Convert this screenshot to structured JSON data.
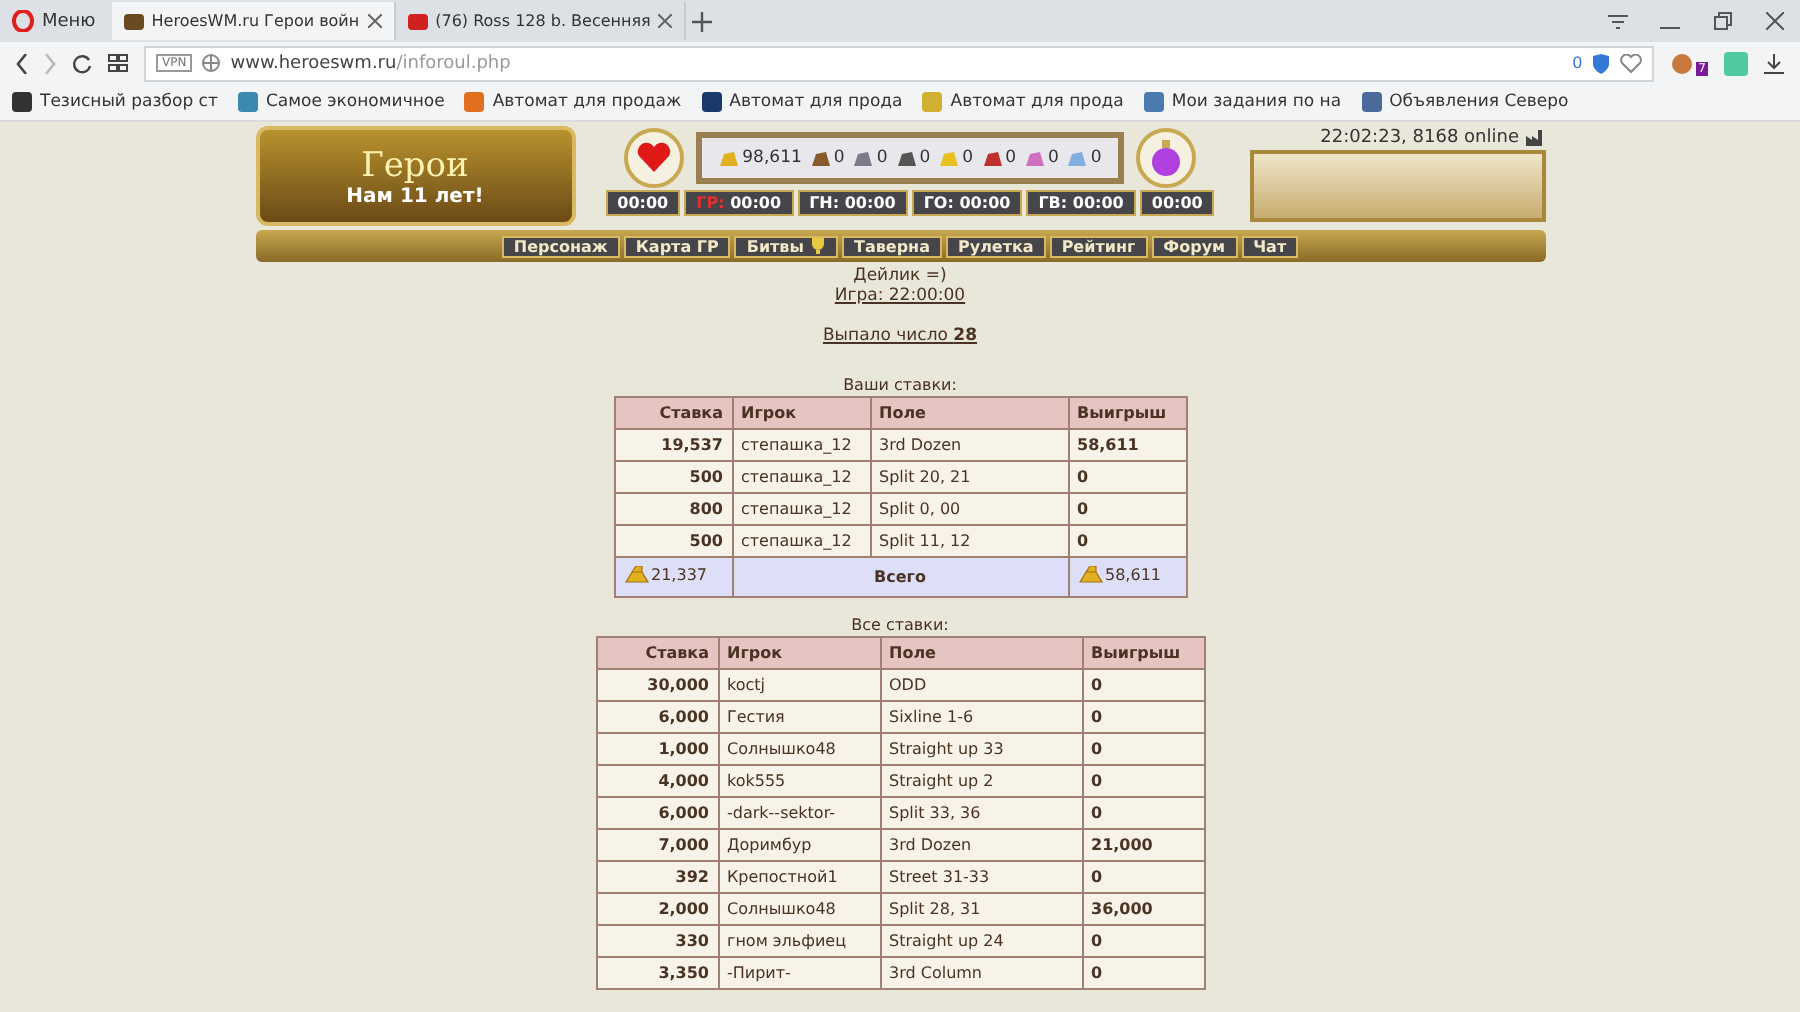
{
  "browser": {
    "menu_label": "Меню",
    "tabs": [
      {
        "title": "HeroesWM.ru Герои войн",
        "selected": true
      },
      {
        "title": "(76) Ross 128 b. Весенняя",
        "selected": false
      }
    ],
    "url": {
      "host": "www.heroeswm.ru",
      "path": "/inforoul.php"
    },
    "vpn_label": "VPN",
    "blocked_count": "0",
    "extension_badge": "7",
    "bookmarks": [
      "Тезисный разбор ст",
      "Самое экономичное",
      "Автомат для продаж",
      "Автомат для прода",
      "Автомат для прода",
      "Мои задания по на",
      "Объявления Северо"
    ]
  },
  "game_header": {
    "logo": {
      "title": "Герои",
      "anniversary": "Нам 11 лет!"
    },
    "clock": "22:02:23, 8168 online",
    "resources": [
      "98,611",
      "0",
      "0",
      "0",
      "0",
      "0",
      "0",
      "0"
    ],
    "timers": [
      {
        "time": "00:00"
      },
      {
        "label": "ГР:",
        "time": "00:00",
        "alert": true
      },
      {
        "label": "ГН:",
        "time": "00:00",
        "alert": false
      },
      {
        "label": "ГО:",
        "time": "00:00",
        "alert": false
      },
      {
        "label": "ГВ:",
        "time": "00:00",
        "alert": false
      },
      {
        "time": "00:00"
      }
    ],
    "nav": [
      {
        "label": "Персонаж",
        "trophy": false
      },
      {
        "label": "Карта ГР",
        "trophy": false
      },
      {
        "label": "Битвы",
        "trophy": true
      },
      {
        "label": "Таверна",
        "trophy": false
      },
      {
        "label": "Рулетка",
        "trophy": false
      },
      {
        "label": "Рейтинг",
        "trophy": false
      },
      {
        "label": "Форум",
        "trophy": false
      },
      {
        "label": "Чат",
        "trophy": false
      }
    ]
  },
  "info": {
    "daily": "Дейлик =)",
    "game_link": "Игра: 22:00:00",
    "result_label": "Выпало число",
    "result_number": "28"
  },
  "my_bets": {
    "title": "Ваши ставки:",
    "columns": [
      "Ставка",
      "Игрок",
      "Поле",
      "Выигрыш"
    ],
    "rows": [
      [
        "19,537",
        "степашка_12",
        "3rd Dozen",
        "58,611"
      ],
      [
        "500",
        "степашка_12",
        "Split 20, 21",
        "0"
      ],
      [
        "800",
        "степашка_12",
        "Split 0, 00",
        "0"
      ],
      [
        "500",
        "степашка_12",
        "Split 11, 12",
        "0"
      ]
    ],
    "total": {
      "bet": "21,337",
      "label": "Всего",
      "win": "58,611"
    }
  },
  "all_bets": {
    "title": "Все ставки:",
    "columns": [
      "Ставка",
      "Игрок",
      "Поле",
      "Выигрыш"
    ],
    "rows": [
      [
        "30,000",
        "koctj",
        "ODD",
        "0"
      ],
      [
        "6,000",
        "Гестия",
        "Sixline 1-6",
        "0"
      ],
      [
        "1,000",
        "Солнышко48",
        "Straight up 33",
        "0"
      ],
      [
        "4,000",
        "kok555",
        "Straight up 2",
        "0"
      ],
      [
        "6,000",
        "-dark--sektor-",
        "Split 33, 36",
        "0"
      ],
      [
        "7,000",
        "Доримбур",
        "3rd Dozen",
        "21,000"
      ],
      [
        "392",
        "Крепостной1",
        "Street 31-33",
        "0"
      ],
      [
        "2,000",
        "Солнышко48",
        "Split 28, 31",
        "36,000"
      ],
      [
        "330",
        "гном эльфиец",
        "Straight up 24",
        "0"
      ],
      [
        "3,350",
        "-Пирит-",
        "3rd Column",
        "0"
      ]
    ]
  }
}
